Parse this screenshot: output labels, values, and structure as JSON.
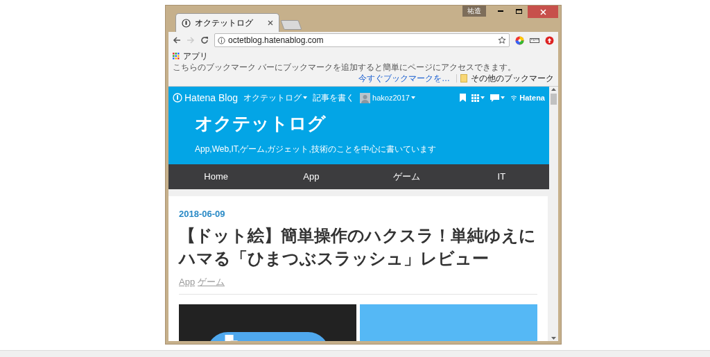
{
  "window": {
    "user_badge": "祐造"
  },
  "tabs": [
    {
      "title": "オクテットログ",
      "selected": true
    }
  ],
  "address_bar": {
    "url": "octetblog.hatenablog.com"
  },
  "bookmarks_bar": {
    "apps": "アプリ",
    "message": "こちらのブックマーク バーにブックマークを追加すると簡単にページにアクセスできます。",
    "link": "今すぐブックマークを…",
    "other": "その他のブックマーク"
  },
  "hatena_bar": {
    "logo": "Hatena Blog",
    "blog_menu": "オクテットログ",
    "write": "記事を書く",
    "user": "hakoz2017",
    "brand": "Hatena"
  },
  "blog": {
    "title": "オクテットログ",
    "description": "App,Web,IT,ゲーム,ガジェット,技術のことを中心に書いています"
  },
  "nav": [
    {
      "label": "Home"
    },
    {
      "label": "App"
    },
    {
      "label": "ゲーム"
    },
    {
      "label": "IT"
    }
  ],
  "article": {
    "date": "2018-06-09",
    "title": "【ドット絵】簡単操作のハクスラ！単純ゆえにハマる「ひまつぶスラッシュ」レビュー",
    "categories": [
      "App",
      "ゲーム"
    ]
  }
}
